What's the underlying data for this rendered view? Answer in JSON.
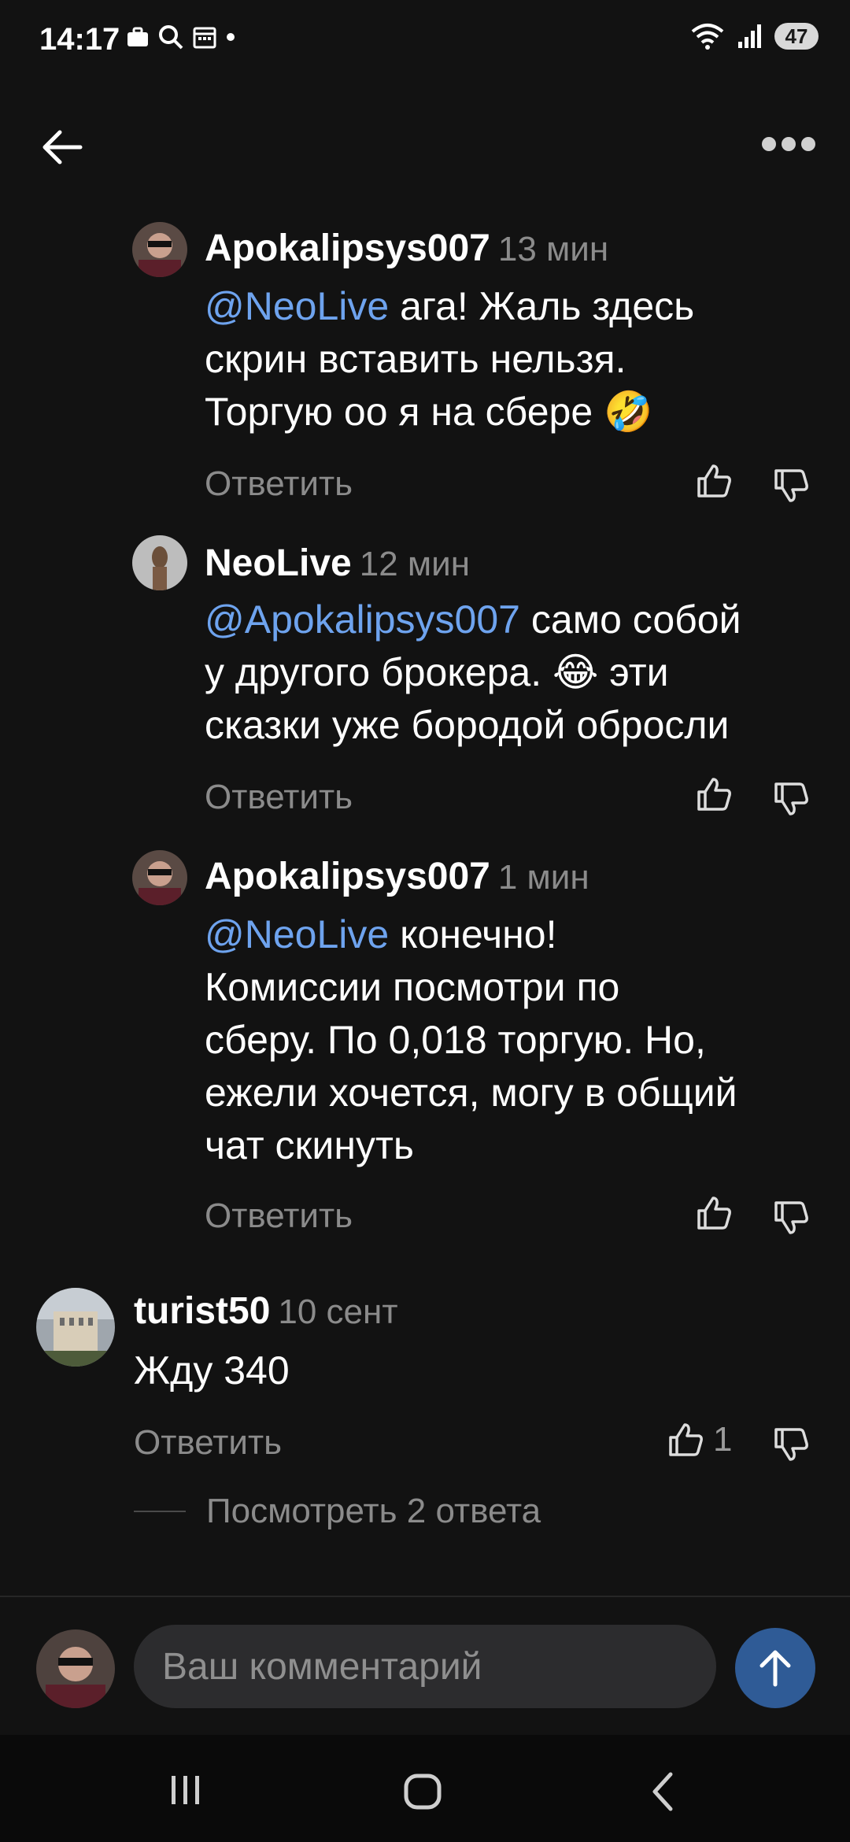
{
  "status_bar": {
    "time": "14:17",
    "battery": "47"
  },
  "comments": [
    {
      "author": "Apokalipsys007",
      "time": "13 мин",
      "mention": "@NeoLive",
      "line1": "ага! Жаль здесь",
      "line2": "скрин вставить нельзя.",
      "line3": "Торгую оо я на сбере 🤣",
      "reply": "Ответить"
    },
    {
      "author": "NeoLive",
      "time": "12 мин",
      "mention": "@Apokalipsys007",
      "line1": "само собой",
      "line2": "у другого брокера. 😂 эти",
      "line3": "сказки уже бородой обросли",
      "reply": "Ответить"
    },
    {
      "author": "Apokalipsys007",
      "time": "1 мин",
      "mention": "@NeoLive",
      "line1": "конечно!",
      "line2": "Комиссии посмотри по",
      "line3": "сберу. По 0,018 торгую. Но,",
      "line4": "ежели хочется, могу в общий",
      "line5": "чат скинуть",
      "reply": "Ответить"
    },
    {
      "author": "turist50",
      "time": "10 сент",
      "line1": "Жду 340",
      "reply": "Ответить",
      "likes": "1"
    }
  ],
  "view_replies": "Посмотреть 2 ответа",
  "composer": {
    "placeholder": "Ваш комментарий"
  },
  "colors": {
    "background": "#121212",
    "mention": "#6ea3ee",
    "muted": "#8b8b8b",
    "send": "#2f5b96",
    "input_bg": "#2c2c2e"
  }
}
